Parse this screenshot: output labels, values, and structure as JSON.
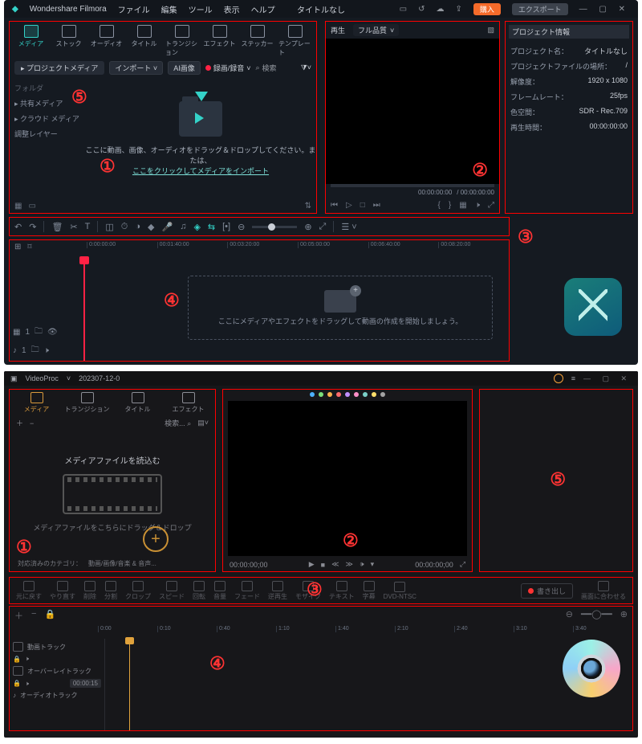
{
  "filmora": {
    "app_name": "Wondershare Filmora",
    "menu": [
      "ファイル",
      "編集",
      "ツール",
      "表示",
      "ヘルプ"
    ],
    "doc_title": "タイトルなし",
    "buy": "購入",
    "export": "エクスポート",
    "tabs": [
      {
        "label": "メディア"
      },
      {
        "label": "ストック"
      },
      {
        "label": "オーディオ"
      },
      {
        "label": "タイトル"
      },
      {
        "label": "トランジション"
      },
      {
        "label": "エフェクト"
      },
      {
        "label": "ステッカー"
      },
      {
        "label": "テンプレート"
      }
    ],
    "project_media": "プロジェクトメディア",
    "import": "インポート",
    "ai_image": "AI画像",
    "record": "録画/録音",
    "search": "検索",
    "sidebar": {
      "folder": "フォルダ",
      "items": [
        "共有メディア",
        "クラウド メディア",
        "調整レイヤー"
      ]
    },
    "drop_text": "ここに動画、画像、オーディオをドラッグ＆ドロップしてください。または、",
    "drop_link": "ここをクリックしてメディアをインポート",
    "preview": {
      "play": "再生",
      "quality": "フル品質",
      "tc": "00:00:00:00",
      "dur": "/  00:00:00:00"
    },
    "info": {
      "header": "プロジェクト情報",
      "name_k": "プロジェクト名：",
      "name_v": "タイトルなし",
      "loc_k": "プロジェクトファイルの場所：",
      "loc_v": "/",
      "res_k": "解像度：",
      "res_v": "1920 x 1080",
      "fps_k": "フレームレート：",
      "fps_v": "25fps",
      "cs_k": "色空間：",
      "cs_v": "SDR - Rec.709",
      "dur_k": "再生時間：",
      "dur_v": "00:00:00:00"
    },
    "ruler": [
      "0:00:00:00",
      "00:01:40:00",
      "00:03:20:00",
      "00:05:00:00",
      "00:06:40:00",
      "00:08:20:00"
    ],
    "tl_drop": "ここにメディアやエフェクトをドラッグして動画の作成を開始しましょう。",
    "nums": {
      "n1": "①",
      "n2": "②",
      "n3": "③",
      "n4": "④",
      "n5": "⑤"
    }
  },
  "vp": {
    "app_name": "VideoProc",
    "date": "202307-12-0",
    "tabs": [
      {
        "label": "メディア"
      },
      {
        "label": "トランジション"
      },
      {
        "label": "タイトル"
      },
      {
        "label": "エフェクト"
      }
    ],
    "search": "検索...",
    "drop_title": "メディアファイルを読込む",
    "drop_sub": "メディアファイルをこちらにドラッグ＆ドロップ",
    "cat_label": "対応済みのカテゴリ：",
    "cat_val": "動画/画像/音楽 & 音声...",
    "tc": "00:00:00;00",
    "dur": "00:00:00;00",
    "tools": [
      "元に戻す",
      "やり直す",
      "削除",
      "分割",
      "クロップ",
      "スピード",
      "回転",
      "音量",
      "フェード",
      "逆再生",
      "モザイク",
      "テキスト",
      "字幕",
      "DVD-NTSC"
    ],
    "save": "書き出し",
    "fit": "画面に合わせる",
    "ruler": [
      "0:00",
      "0:10",
      "0:40",
      "1:10",
      "1:40",
      "2:10",
      "2:40",
      "3:10",
      "3:40"
    ],
    "tracks": [
      "動画トラック",
      "オーバーレイトラック",
      "オーディオトラック"
    ],
    "clip": "00:00:15",
    "nums": {
      "n1": "①",
      "n2": "②",
      "n3": "③",
      "n4": "④",
      "n5": "⑤"
    }
  }
}
